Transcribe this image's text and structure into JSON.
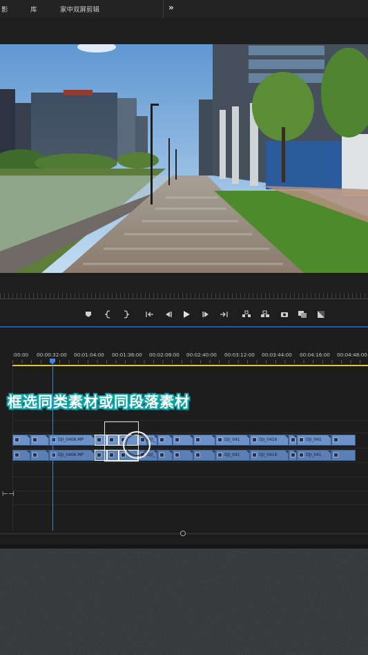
{
  "workspace": {
    "tabs": [
      {
        "label": "影"
      },
      {
        "label": "库"
      },
      {
        "label": "家中双屏剪辑"
      }
    ],
    "overflow": "»"
  },
  "transport": {
    "buttons": [
      "add-marker-icon",
      "mark-in-icon",
      "mark-out-icon",
      "go-to-in-icon",
      "step-back-icon",
      "play-icon",
      "step-forward-icon",
      "go-to-out-icon",
      "lift-icon",
      "extract-icon",
      "export-frame-icon",
      "comparison-view-icon",
      "proxy-toggle-icon"
    ]
  },
  "timeline": {
    "timecodes": [
      ":00:00",
      "00:00:32:00",
      "00:01:04:00",
      "00:01:36:00",
      "00:02:08:00",
      "00:02:40:00",
      "00:03:12:00",
      "00:03:44:00",
      "00:04:16:00",
      "00:04:48:00"
    ],
    "caption": "框选同类素材或同段落素材",
    "video_clips": [
      {
        "label": ""
      },
      {
        "label": ""
      },
      {
        "label": "DJI_0406.MP"
      },
      {
        "label": ""
      },
      {
        "label": ""
      },
      {
        "label": ""
      },
      {
        "label": "DJI_"
      },
      {
        "label": ""
      },
      {
        "label": ""
      },
      {
        "label": ""
      },
      {
        "label": "DJI_041"
      },
      {
        "label": "DJI_0416"
      },
      {
        "label": ""
      },
      {
        "label": "DJI_041"
      },
      {
        "label": ""
      }
    ],
    "audio_clips": [
      {
        "label": ""
      },
      {
        "label": ""
      },
      {
        "label": "DJI_0406.MP"
      },
      {
        "label": ""
      },
      {
        "label": ""
      },
      {
        "label": ""
      },
      {
        "label": "DJI_"
      },
      {
        "label": ""
      },
      {
        "label": ""
      },
      {
        "label": ""
      },
      {
        "label": "DJI_041"
      },
      {
        "label": "DJI_0416"
      },
      {
        "label": ""
      },
      {
        "label": "DJI_041"
      },
      {
        "label": ""
      }
    ],
    "track_button": "⊢⊣"
  },
  "colors": {
    "accent": "#3a86e8",
    "clip": "#6e93c9",
    "caption_outline": "#0aa3a8",
    "work_area": "#d9c84b"
  }
}
